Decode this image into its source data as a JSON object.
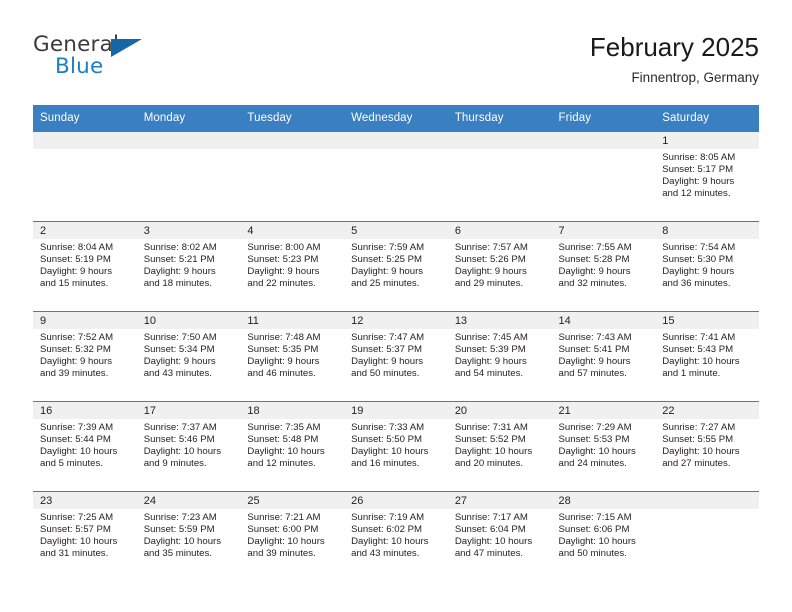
{
  "brand": {
    "name_part1": "General",
    "name_part2": "Blue",
    "flag_icon": "triangle-flag-icon"
  },
  "header": {
    "title": "February 2025",
    "subtitle": "Finnentrop, Germany"
  },
  "colors": {
    "header_blue": "#3a7fc1",
    "daynum_band": "#f0f0f0",
    "brand_blue": "#1c7fc4",
    "text": "#231f20"
  },
  "calendar": {
    "weekday_headers": [
      "Sunday",
      "Monday",
      "Tuesday",
      "Wednesday",
      "Thursday",
      "Friday",
      "Saturday"
    ],
    "weeks": [
      [
        {
          "day": "",
          "lines": []
        },
        {
          "day": "",
          "lines": []
        },
        {
          "day": "",
          "lines": []
        },
        {
          "day": "",
          "lines": []
        },
        {
          "day": "",
          "lines": []
        },
        {
          "day": "",
          "lines": []
        },
        {
          "day": "1",
          "lines": [
            "Sunrise: 8:05 AM",
            "Sunset: 5:17 PM",
            "Daylight: 9 hours",
            "and 12 minutes."
          ]
        }
      ],
      [
        {
          "day": "2",
          "lines": [
            "Sunrise: 8:04 AM",
            "Sunset: 5:19 PM",
            "Daylight: 9 hours",
            "and 15 minutes."
          ]
        },
        {
          "day": "3",
          "lines": [
            "Sunrise: 8:02 AM",
            "Sunset: 5:21 PM",
            "Daylight: 9 hours",
            "and 18 minutes."
          ]
        },
        {
          "day": "4",
          "lines": [
            "Sunrise: 8:00 AM",
            "Sunset: 5:23 PM",
            "Daylight: 9 hours",
            "and 22 minutes."
          ]
        },
        {
          "day": "5",
          "lines": [
            "Sunrise: 7:59 AM",
            "Sunset: 5:25 PM",
            "Daylight: 9 hours",
            "and 25 minutes."
          ]
        },
        {
          "day": "6",
          "lines": [
            "Sunrise: 7:57 AM",
            "Sunset: 5:26 PM",
            "Daylight: 9 hours",
            "and 29 minutes."
          ]
        },
        {
          "day": "7",
          "lines": [
            "Sunrise: 7:55 AM",
            "Sunset: 5:28 PM",
            "Daylight: 9 hours",
            "and 32 minutes."
          ]
        },
        {
          "day": "8",
          "lines": [
            "Sunrise: 7:54 AM",
            "Sunset: 5:30 PM",
            "Daylight: 9 hours",
            "and 36 minutes."
          ]
        }
      ],
      [
        {
          "day": "9",
          "lines": [
            "Sunrise: 7:52 AM",
            "Sunset: 5:32 PM",
            "Daylight: 9 hours",
            "and 39 minutes."
          ]
        },
        {
          "day": "10",
          "lines": [
            "Sunrise: 7:50 AM",
            "Sunset: 5:34 PM",
            "Daylight: 9 hours",
            "and 43 minutes."
          ]
        },
        {
          "day": "11",
          "lines": [
            "Sunrise: 7:48 AM",
            "Sunset: 5:35 PM",
            "Daylight: 9 hours",
            "and 46 minutes."
          ]
        },
        {
          "day": "12",
          "lines": [
            "Sunrise: 7:47 AM",
            "Sunset: 5:37 PM",
            "Daylight: 9 hours",
            "and 50 minutes."
          ]
        },
        {
          "day": "13",
          "lines": [
            "Sunrise: 7:45 AM",
            "Sunset: 5:39 PM",
            "Daylight: 9 hours",
            "and 54 minutes."
          ]
        },
        {
          "day": "14",
          "lines": [
            "Sunrise: 7:43 AM",
            "Sunset: 5:41 PM",
            "Daylight: 9 hours",
            "and 57 minutes."
          ]
        },
        {
          "day": "15",
          "lines": [
            "Sunrise: 7:41 AM",
            "Sunset: 5:43 PM",
            "Daylight: 10 hours",
            "and 1 minute."
          ]
        }
      ],
      [
        {
          "day": "16",
          "lines": [
            "Sunrise: 7:39 AM",
            "Sunset: 5:44 PM",
            "Daylight: 10 hours",
            "and 5 minutes."
          ]
        },
        {
          "day": "17",
          "lines": [
            "Sunrise: 7:37 AM",
            "Sunset: 5:46 PM",
            "Daylight: 10 hours",
            "and 9 minutes."
          ]
        },
        {
          "day": "18",
          "lines": [
            "Sunrise: 7:35 AM",
            "Sunset: 5:48 PM",
            "Daylight: 10 hours",
            "and 12 minutes."
          ]
        },
        {
          "day": "19",
          "lines": [
            "Sunrise: 7:33 AM",
            "Sunset: 5:50 PM",
            "Daylight: 10 hours",
            "and 16 minutes."
          ]
        },
        {
          "day": "20",
          "lines": [
            "Sunrise: 7:31 AM",
            "Sunset: 5:52 PM",
            "Daylight: 10 hours",
            "and 20 minutes."
          ]
        },
        {
          "day": "21",
          "lines": [
            "Sunrise: 7:29 AM",
            "Sunset: 5:53 PM",
            "Daylight: 10 hours",
            "and 24 minutes."
          ]
        },
        {
          "day": "22",
          "lines": [
            "Sunrise: 7:27 AM",
            "Sunset: 5:55 PM",
            "Daylight: 10 hours",
            "and 27 minutes."
          ]
        }
      ],
      [
        {
          "day": "23",
          "lines": [
            "Sunrise: 7:25 AM",
            "Sunset: 5:57 PM",
            "Daylight: 10 hours",
            "and 31 minutes."
          ]
        },
        {
          "day": "24",
          "lines": [
            "Sunrise: 7:23 AM",
            "Sunset: 5:59 PM",
            "Daylight: 10 hours",
            "and 35 minutes."
          ]
        },
        {
          "day": "25",
          "lines": [
            "Sunrise: 7:21 AM",
            "Sunset: 6:00 PM",
            "Daylight: 10 hours",
            "and 39 minutes."
          ]
        },
        {
          "day": "26",
          "lines": [
            "Sunrise: 7:19 AM",
            "Sunset: 6:02 PM",
            "Daylight: 10 hours",
            "and 43 minutes."
          ]
        },
        {
          "day": "27",
          "lines": [
            "Sunrise: 7:17 AM",
            "Sunset: 6:04 PM",
            "Daylight: 10 hours",
            "and 47 minutes."
          ]
        },
        {
          "day": "28",
          "lines": [
            "Sunrise: 7:15 AM",
            "Sunset: 6:06 PM",
            "Daylight: 10 hours",
            "and 50 minutes."
          ]
        },
        {
          "day": "",
          "lines": []
        }
      ]
    ]
  }
}
